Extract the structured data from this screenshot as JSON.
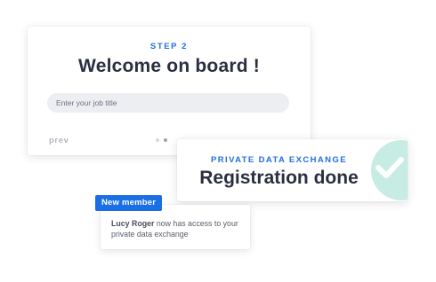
{
  "onboarding": {
    "step_label": "STEP 2",
    "title": "Welcome on board !",
    "job_input": {
      "placeholder": "Enter your job title",
      "value": ""
    },
    "prev_label": "prev",
    "pager": {
      "total": 2,
      "active": 2
    }
  },
  "registration": {
    "label": "PRIVATE DATA EXCHANGE",
    "title": "Registration done",
    "icon": "checkmark-icon",
    "colors": {
      "circle": "#c6ece3",
      "check": "#ffffff"
    }
  },
  "notification": {
    "badge": "New member",
    "user_name": "Lucy Roger",
    "message": " now has access to your private data exchange"
  },
  "colors": {
    "accent": "#1f6fe0",
    "badge": "#1a6fe6",
    "title_text": "#2c2f42"
  }
}
